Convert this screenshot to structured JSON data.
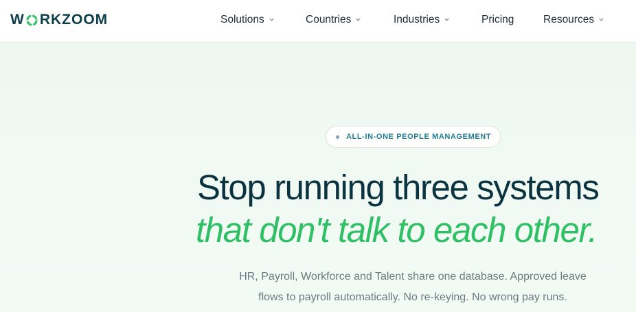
{
  "brand": {
    "logo_text_before": "W",
    "logo_text_after": "RKZOOM",
    "logo_accent_color": "#2fc065",
    "logo_color": "#0b3e4a"
  },
  "nav": {
    "items": [
      {
        "label": "Solutions",
        "has_dropdown": true
      },
      {
        "label": "Countries",
        "has_dropdown": true
      },
      {
        "label": "Industries",
        "has_dropdown": true
      },
      {
        "label": "Pricing",
        "has_dropdown": false
      },
      {
        "label": "Resources",
        "has_dropdown": true
      }
    ]
  },
  "hero": {
    "badge": "ALL-IN-ONE PEOPLE MANAGEMENT",
    "headline_line1": "Stop running three systems",
    "headline_line2": "that don't talk to each other.",
    "subtext_line1": "HR, Payroll, Workforce and Talent share one database. Approved leave",
    "subtext_line2": "flows to payroll automatically. No re-keying. No wrong pay runs.",
    "headline_color": "#0c3440",
    "accent_color": "#2fc065"
  },
  "icons": {
    "logo_mark": "ring-icon",
    "dropdown": "chevron-down-icon"
  }
}
